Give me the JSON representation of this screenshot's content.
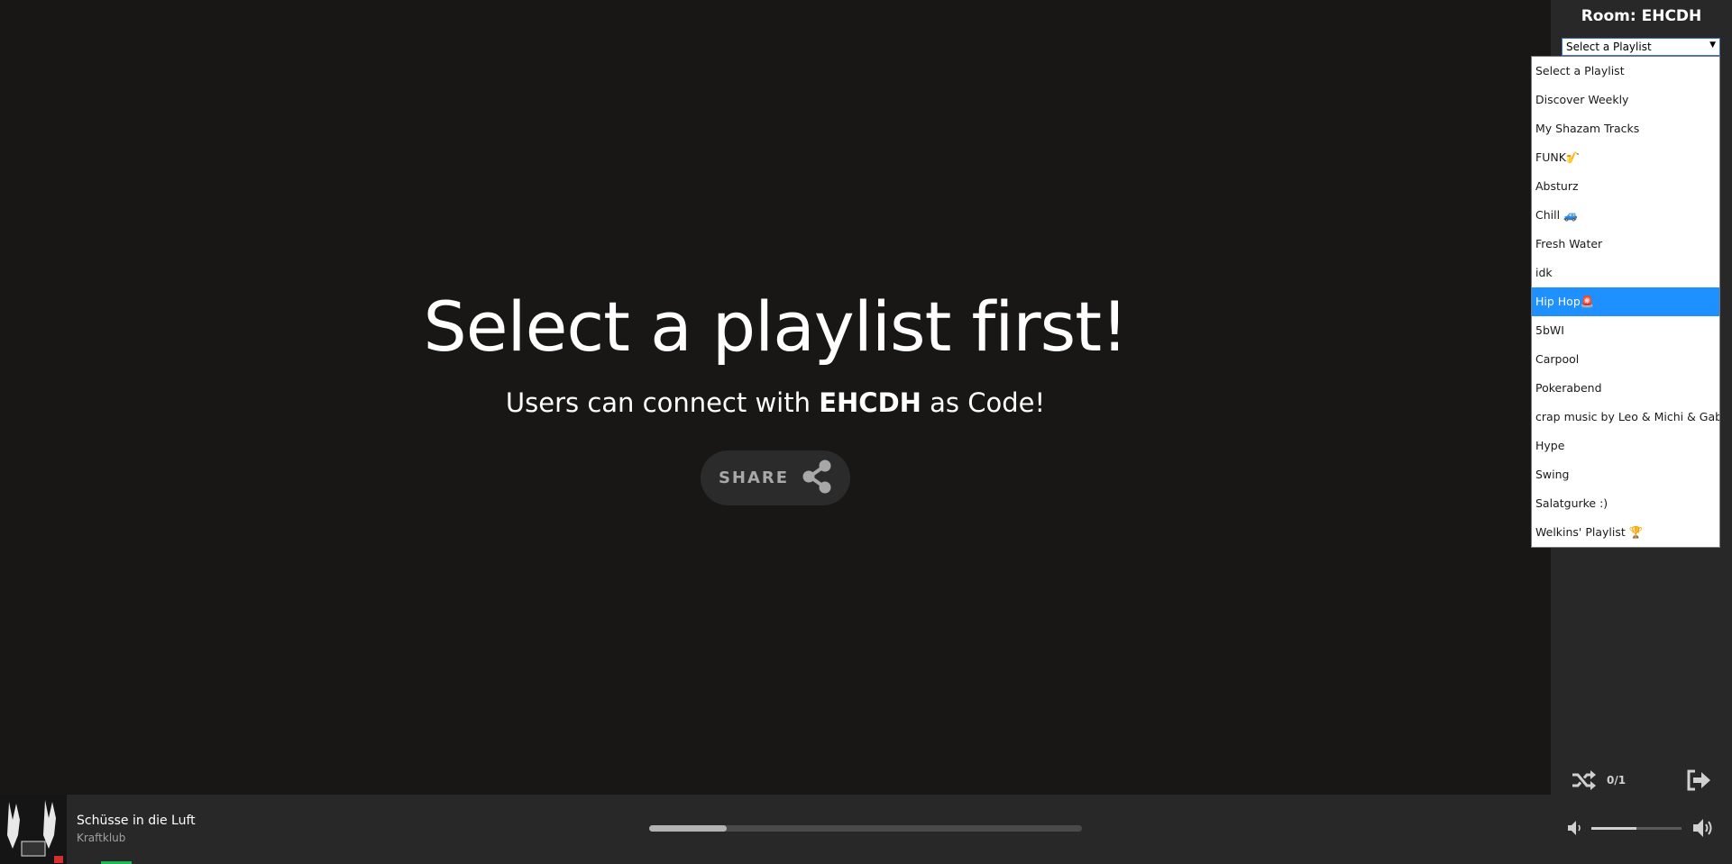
{
  "main": {
    "headline": "Select a playlist first!",
    "subline_prefix": "Users can connect with ",
    "subline_code": "EHCDH",
    "subline_suffix": " as Code!",
    "share_label": "SHARE",
    "share_icon": "share-icon"
  },
  "sidebar": {
    "room_title": "Room: EHCDH",
    "select_value": "Select a Playlist",
    "select_arrow": "▼",
    "queue_count": "0/1",
    "shuffle_icon": "shuffle-icon",
    "exit_icon": "exit-icon"
  },
  "dropdown": {
    "options": [
      "Select a Playlist",
      "Discover Weekly",
      "My Shazam Tracks",
      "FUNK🎷",
      "Absturz",
      "Chill 🚙",
      "Fresh Water",
      "idk",
      "Hip Hop🚨",
      "5bWI",
      "Carpool",
      "Pokerabend",
      "crap music by Leo & Michi & Gabsi",
      "Hype",
      "Swing",
      "Salatgurke :)",
      "Welkins' Playlist 🏆"
    ],
    "selected_index": 8
  },
  "player": {
    "track_title": "Schüsse in die Luft",
    "track_artist": "Kraftklub",
    "progress": 0.18,
    "volume": 0.5,
    "mute_icon": "volume-mute-icon",
    "volume_icon": "volume-high-icon"
  },
  "colors": {
    "background": "#191616",
    "sidebar": "#282828",
    "highlight": "#1e90ff",
    "accent": "#1db954"
  }
}
